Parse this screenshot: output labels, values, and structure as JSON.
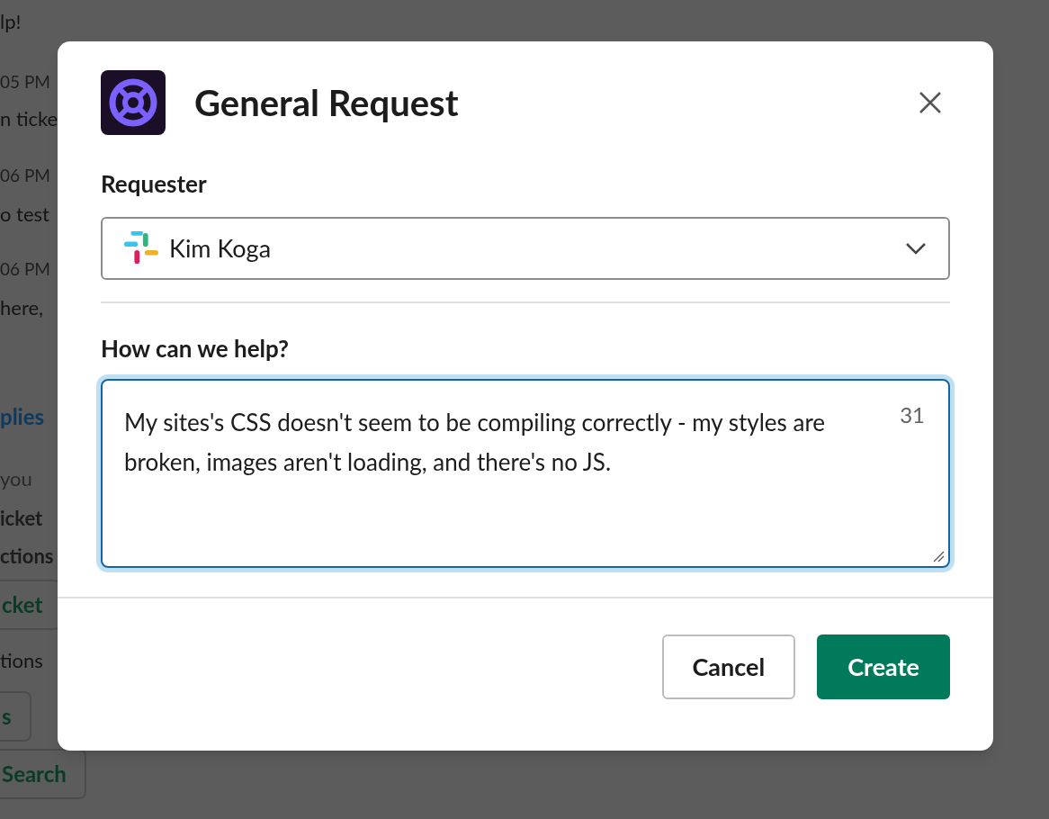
{
  "background": {
    "items": [
      {
        "kind": "text",
        "text": "lp!"
      },
      {
        "kind": "time",
        "text": "05 PM"
      },
      {
        "kind": "text",
        "text": "n ticke"
      },
      {
        "kind": "time",
        "text": "06 PM"
      },
      {
        "kind": "text",
        "text": "o test"
      },
      {
        "kind": "time",
        "text": "06 PM"
      },
      {
        "kind": "text",
        "text": "here,"
      },
      {
        "kind": "link",
        "text": "plies"
      },
      {
        "kind": "small",
        "text": "you"
      },
      {
        "kind": "bold",
        "text": "icket"
      },
      {
        "kind": "bold",
        "text": "ctions"
      },
      {
        "kind": "button",
        "text": "cket"
      },
      {
        "kind": "text",
        "text": "tions"
      },
      {
        "kind": "button",
        "text": "s"
      },
      {
        "kind": "button",
        "text": "Search"
      }
    ]
  },
  "dialog": {
    "title": "General Request",
    "requester": {
      "label": "Requester",
      "value": "Kim Koga"
    },
    "help": {
      "label": "How can we help?",
      "value": "My sites's CSS doesn't seem to be compiling correctly - my styles are broken, images aren't loading, and there's no JS.",
      "counter": "31",
      "focused": true
    },
    "buttons": [
      {
        "label": "Cancel",
        "kind": "secondary"
      },
      {
        "label": "Create",
        "kind": "primary"
      }
    ]
  }
}
